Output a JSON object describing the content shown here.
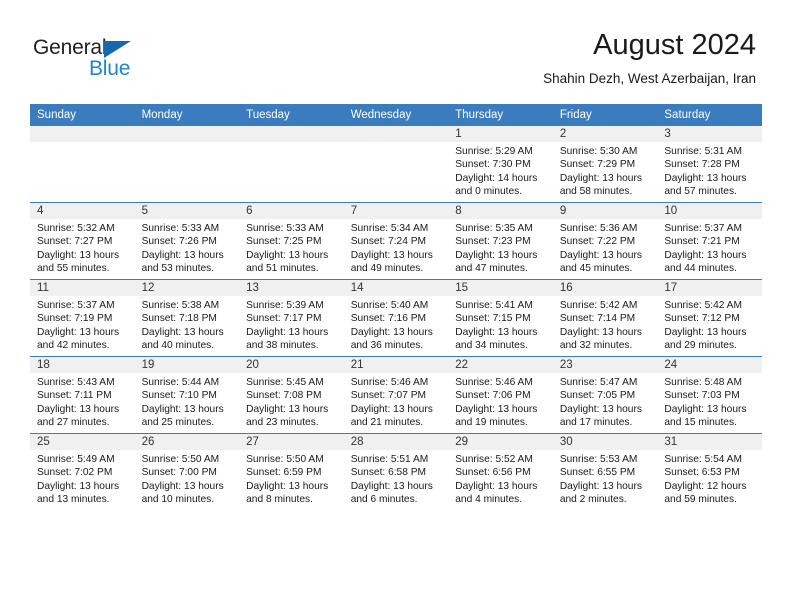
{
  "brand": {
    "name_part1": "General",
    "name_part2": "Blue",
    "color_dark": "#231f20",
    "color_blue": "#1b87d4",
    "triangle_color": "#1668b3"
  },
  "header": {
    "month_title": "August 2024",
    "location": "Shahin Dezh, West Azerbaijan, Iran",
    "accent_color": "#3a7cbe"
  },
  "weekday_headers": [
    "Sunday",
    "Monday",
    "Tuesday",
    "Wednesday",
    "Thursday",
    "Friday",
    "Saturday"
  ],
  "weeks": [
    [
      {
        "day": "",
        "empty": true,
        "sunrise": "",
        "sunset": "",
        "daylight1": "",
        "daylight2": ""
      },
      {
        "day": "",
        "empty": true,
        "sunrise": "",
        "sunset": "",
        "daylight1": "",
        "daylight2": ""
      },
      {
        "day": "",
        "empty": true,
        "sunrise": "",
        "sunset": "",
        "daylight1": "",
        "daylight2": ""
      },
      {
        "day": "",
        "empty": true,
        "sunrise": "",
        "sunset": "",
        "daylight1": "",
        "daylight2": ""
      },
      {
        "day": "1",
        "empty": false,
        "sunrise": "Sunrise: 5:29 AM",
        "sunset": "Sunset: 7:30 PM",
        "daylight1": "Daylight: 14 hours",
        "daylight2": "and 0 minutes."
      },
      {
        "day": "2",
        "empty": false,
        "sunrise": "Sunrise: 5:30 AM",
        "sunset": "Sunset: 7:29 PM",
        "daylight1": "Daylight: 13 hours",
        "daylight2": "and 58 minutes."
      },
      {
        "day": "3",
        "empty": false,
        "sunrise": "Sunrise: 5:31 AM",
        "sunset": "Sunset: 7:28 PM",
        "daylight1": "Daylight: 13 hours",
        "daylight2": "and 57 minutes."
      }
    ],
    [
      {
        "day": "4",
        "empty": false,
        "sunrise": "Sunrise: 5:32 AM",
        "sunset": "Sunset: 7:27 PM",
        "daylight1": "Daylight: 13 hours",
        "daylight2": "and 55 minutes."
      },
      {
        "day": "5",
        "empty": false,
        "sunrise": "Sunrise: 5:33 AM",
        "sunset": "Sunset: 7:26 PM",
        "daylight1": "Daylight: 13 hours",
        "daylight2": "and 53 minutes."
      },
      {
        "day": "6",
        "empty": false,
        "sunrise": "Sunrise: 5:33 AM",
        "sunset": "Sunset: 7:25 PM",
        "daylight1": "Daylight: 13 hours",
        "daylight2": "and 51 minutes."
      },
      {
        "day": "7",
        "empty": false,
        "sunrise": "Sunrise: 5:34 AM",
        "sunset": "Sunset: 7:24 PM",
        "daylight1": "Daylight: 13 hours",
        "daylight2": "and 49 minutes."
      },
      {
        "day": "8",
        "empty": false,
        "sunrise": "Sunrise: 5:35 AM",
        "sunset": "Sunset: 7:23 PM",
        "daylight1": "Daylight: 13 hours",
        "daylight2": "and 47 minutes."
      },
      {
        "day": "9",
        "empty": false,
        "sunrise": "Sunrise: 5:36 AM",
        "sunset": "Sunset: 7:22 PM",
        "daylight1": "Daylight: 13 hours",
        "daylight2": "and 45 minutes."
      },
      {
        "day": "10",
        "empty": false,
        "sunrise": "Sunrise: 5:37 AM",
        "sunset": "Sunset: 7:21 PM",
        "daylight1": "Daylight: 13 hours",
        "daylight2": "and 44 minutes."
      }
    ],
    [
      {
        "day": "11",
        "empty": false,
        "sunrise": "Sunrise: 5:37 AM",
        "sunset": "Sunset: 7:19 PM",
        "daylight1": "Daylight: 13 hours",
        "daylight2": "and 42 minutes."
      },
      {
        "day": "12",
        "empty": false,
        "sunrise": "Sunrise: 5:38 AM",
        "sunset": "Sunset: 7:18 PM",
        "daylight1": "Daylight: 13 hours",
        "daylight2": "and 40 minutes."
      },
      {
        "day": "13",
        "empty": false,
        "sunrise": "Sunrise: 5:39 AM",
        "sunset": "Sunset: 7:17 PM",
        "daylight1": "Daylight: 13 hours",
        "daylight2": "and 38 minutes."
      },
      {
        "day": "14",
        "empty": false,
        "sunrise": "Sunrise: 5:40 AM",
        "sunset": "Sunset: 7:16 PM",
        "daylight1": "Daylight: 13 hours",
        "daylight2": "and 36 minutes."
      },
      {
        "day": "15",
        "empty": false,
        "sunrise": "Sunrise: 5:41 AM",
        "sunset": "Sunset: 7:15 PM",
        "daylight1": "Daylight: 13 hours",
        "daylight2": "and 34 minutes."
      },
      {
        "day": "16",
        "empty": false,
        "sunrise": "Sunrise: 5:42 AM",
        "sunset": "Sunset: 7:14 PM",
        "daylight1": "Daylight: 13 hours",
        "daylight2": "and 32 minutes."
      },
      {
        "day": "17",
        "empty": false,
        "sunrise": "Sunrise: 5:42 AM",
        "sunset": "Sunset: 7:12 PM",
        "daylight1": "Daylight: 13 hours",
        "daylight2": "and 29 minutes."
      }
    ],
    [
      {
        "day": "18",
        "empty": false,
        "sunrise": "Sunrise: 5:43 AM",
        "sunset": "Sunset: 7:11 PM",
        "daylight1": "Daylight: 13 hours",
        "daylight2": "and 27 minutes."
      },
      {
        "day": "19",
        "empty": false,
        "sunrise": "Sunrise: 5:44 AM",
        "sunset": "Sunset: 7:10 PM",
        "daylight1": "Daylight: 13 hours",
        "daylight2": "and 25 minutes."
      },
      {
        "day": "20",
        "empty": false,
        "sunrise": "Sunrise: 5:45 AM",
        "sunset": "Sunset: 7:08 PM",
        "daylight1": "Daylight: 13 hours",
        "daylight2": "and 23 minutes."
      },
      {
        "day": "21",
        "empty": false,
        "sunrise": "Sunrise: 5:46 AM",
        "sunset": "Sunset: 7:07 PM",
        "daylight1": "Daylight: 13 hours",
        "daylight2": "and 21 minutes."
      },
      {
        "day": "22",
        "empty": false,
        "sunrise": "Sunrise: 5:46 AM",
        "sunset": "Sunset: 7:06 PM",
        "daylight1": "Daylight: 13 hours",
        "daylight2": "and 19 minutes."
      },
      {
        "day": "23",
        "empty": false,
        "sunrise": "Sunrise: 5:47 AM",
        "sunset": "Sunset: 7:05 PM",
        "daylight1": "Daylight: 13 hours",
        "daylight2": "and 17 minutes."
      },
      {
        "day": "24",
        "empty": false,
        "sunrise": "Sunrise: 5:48 AM",
        "sunset": "Sunset: 7:03 PM",
        "daylight1": "Daylight: 13 hours",
        "daylight2": "and 15 minutes."
      }
    ],
    [
      {
        "day": "25",
        "empty": false,
        "sunrise": "Sunrise: 5:49 AM",
        "sunset": "Sunset: 7:02 PM",
        "daylight1": "Daylight: 13 hours",
        "daylight2": "and 13 minutes."
      },
      {
        "day": "26",
        "empty": false,
        "sunrise": "Sunrise: 5:50 AM",
        "sunset": "Sunset: 7:00 PM",
        "daylight1": "Daylight: 13 hours",
        "daylight2": "and 10 minutes."
      },
      {
        "day": "27",
        "empty": false,
        "sunrise": "Sunrise: 5:50 AM",
        "sunset": "Sunset: 6:59 PM",
        "daylight1": "Daylight: 13 hours",
        "daylight2": "and 8 minutes."
      },
      {
        "day": "28",
        "empty": false,
        "sunrise": "Sunrise: 5:51 AM",
        "sunset": "Sunset: 6:58 PM",
        "daylight1": "Daylight: 13 hours",
        "daylight2": "and 6 minutes."
      },
      {
        "day": "29",
        "empty": false,
        "sunrise": "Sunrise: 5:52 AM",
        "sunset": "Sunset: 6:56 PM",
        "daylight1": "Daylight: 13 hours",
        "daylight2": "and 4 minutes."
      },
      {
        "day": "30",
        "empty": false,
        "sunrise": "Sunrise: 5:53 AM",
        "sunset": "Sunset: 6:55 PM",
        "daylight1": "Daylight: 13 hours",
        "daylight2": "and 2 minutes."
      },
      {
        "day": "31",
        "empty": false,
        "sunrise": "Sunrise: 5:54 AM",
        "sunset": "Sunset: 6:53 PM",
        "daylight1": "Daylight: 12 hours",
        "daylight2": "and 59 minutes."
      }
    ]
  ]
}
